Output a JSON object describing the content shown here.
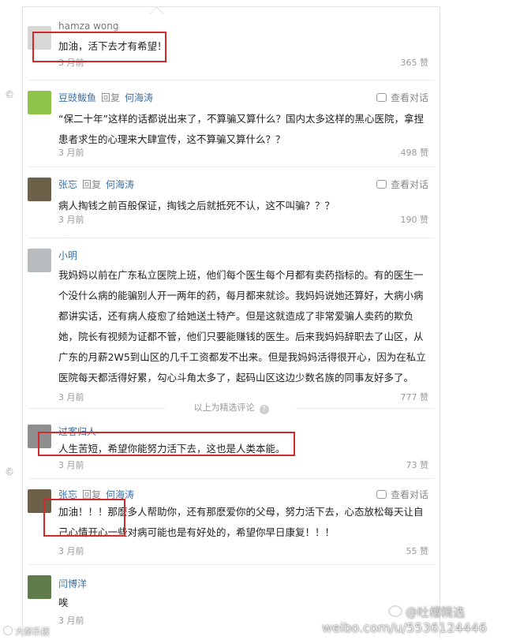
{
  "side_marks": [
    "©",
    "©"
  ],
  "comments": [
    {
      "name": "hamza wong",
      "text": "加油，活下去才有希望！",
      "time": "3 月前",
      "likes": "365 赞"
    },
    {
      "name": "豆豉鲅鱼",
      "reply_word": "回复",
      "reply_to": "何海涛",
      "view": "查看对话",
      "text": "“保二十年”这样的话都说出来了，不算骗又算什么？国内太多这样的黑心医院，拿捏患者求生的心理来大肆宣传，这不算骗又算什么？？",
      "time": "3 月前",
      "likes": "498 赞"
    },
    {
      "name": "张忘",
      "reply_word": "回复",
      "reply_to": "何海涛",
      "view": "查看对话",
      "text": "病人掏钱之前百般保证，掏钱之后就抵死不认，这不叫骗？？？",
      "time": "3 月前",
      "likes": "190 赞"
    },
    {
      "name": "小明",
      "text": "我妈妈以前在广东私立医院上班，他们每个医生每个月都有卖药指标的。有的医生一个没什么病的能骗别人开一两年的药，每月都来就诊。我妈妈说她还算好，大病小病都讲实话，还有病人疫愈了给她送土特产。但是这就造成了非常爱骗人卖药的欺负她，院长有视频为证都不管，他们只要能赚钱的医生。后来我妈妈辞职去了山区，从广东的月薪2W5到山区的几千工资都发不出来。但是我妈妈活得很开心，因为在私立医院每天都活得好累，勾心斗角太多了，起码山区这边少数名族的同事友好多了。",
      "time": "3 月前",
      "likes": "777 赞"
    },
    {
      "name": "过客归人",
      "text": "人生苦短，希望你能努力活下去，这也是人类本能。",
      "time": "3 月前",
      "likes": "73 赞"
    },
    {
      "name": "张忘",
      "reply_word": "回复",
      "reply_to": "何海涛",
      "view": "查看对话",
      "text": "加油！！！那麽多人帮助你，还有那麽爱你的父母，努力活下去，心态放松每天让自己心情开心一些对病可能也是有好处的，希望你早日康复！！！",
      "time": "3 月前",
      "likes": "55 赞"
    },
    {
      "name": "闫博洋",
      "text": "唉",
      "time": "3 月前"
    }
  ],
  "selected_label": "以上为精选评论",
  "watermark": {
    "top": "@吐槽精选",
    "url": "weibo.com/u/5536124446",
    "corner": "大都乐报"
  },
  "colors": {
    "name_link": "#3b6fa5",
    "highlight_box": "#d22a2a"
  }
}
